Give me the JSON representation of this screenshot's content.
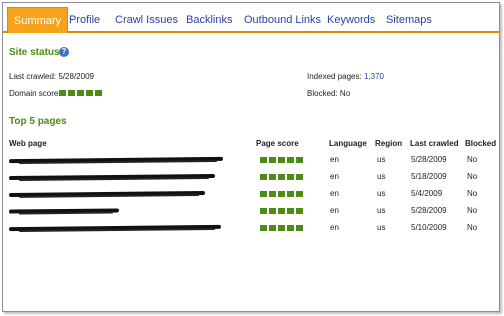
{
  "tabs": [
    {
      "label": "Summary",
      "active": true
    },
    {
      "label": "Profile",
      "active": false
    },
    {
      "label": "Crawl Issues",
      "active": false
    },
    {
      "label": "Backlinks",
      "active": false
    },
    {
      "label": "Outbound Links",
      "active": false
    },
    {
      "label": "Keywords",
      "active": false
    },
    {
      "label": "Sitemaps",
      "active": false
    }
  ],
  "site_status": {
    "heading": "Site status",
    "help_icon": "question-mark",
    "last_crawled_label": "Last crawled:",
    "last_crawled_value": "5/28/2009",
    "domain_score_label": "Domain score:",
    "domain_score": 5,
    "indexed_pages_label": "Indexed pages:",
    "indexed_pages_value": "1,370",
    "blocked_label": "Blocked:",
    "blocked_value": "No"
  },
  "top_pages": {
    "heading": "Top 5 pages",
    "columns": [
      "Web page",
      "Page score",
      "Language",
      "Region",
      "Last crawled",
      "Blocked"
    ],
    "rows": [
      {
        "page_score": 5,
        "language": "en",
        "region": "us",
        "last_crawled": "5/28/2009",
        "blocked": "No"
      },
      {
        "page_score": 5,
        "language": "en",
        "region": "us",
        "last_crawled": "5/18/2009",
        "blocked": "No"
      },
      {
        "page_score": 5,
        "language": "en",
        "region": "us",
        "last_crawled": "5/4/2009",
        "blocked": "No"
      },
      {
        "page_score": 5,
        "language": "en",
        "region": "us",
        "last_crawled": "5/28/2009",
        "blocked": "No"
      },
      {
        "page_score": 5,
        "language": "en",
        "region": "us",
        "last_crawled": "5/10/2009",
        "blocked": "No"
      }
    ]
  },
  "colors": {
    "accent_tab": "#f7a21b",
    "link": "#2b3fa8",
    "heading_green": "#4c8b16",
    "score_bar": "#4c8b16"
  }
}
